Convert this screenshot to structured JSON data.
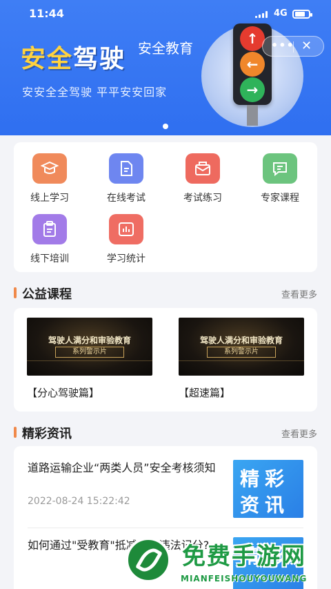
{
  "status_bar": {
    "time": "11:44",
    "network": "4G"
  },
  "banner": {
    "title_part1": "安全",
    "title_part2": "驾驶",
    "subtitle": "安全教育",
    "slogan": "安安全全驾驶  平平安安回家",
    "capsule_more": "•••",
    "capsule_close": "✕",
    "traffic_light_colors": [
      "#e53b2f",
      "#f0872b",
      "#2fb35a"
    ],
    "traffic_light_icons": [
      "up-arrow-icon",
      "left-arrow-icon",
      "right-arrow-icon"
    ],
    "carousel_pages": 1
  },
  "menu": {
    "items": [
      {
        "label": "线上学习",
        "icon": "graduation-cap-icon",
        "color": "#f08a5b"
      },
      {
        "label": "在线考试",
        "icon": "document-icon",
        "color": "#6e86f0"
      },
      {
        "label": "考试练习",
        "icon": "envelope-icon",
        "color": "#ee6a5f"
      },
      {
        "label": "专家课程",
        "icon": "chat-icon",
        "color": "#6cc47e"
      },
      {
        "label": "线下培训",
        "icon": "clipboard-icon",
        "color": "#a27be8"
      },
      {
        "label": "学习统计",
        "icon": "chart-icon",
        "color": "#ef6d63"
      }
    ]
  },
  "courses_section": {
    "title": "公益课程",
    "more": "查看更多",
    "items": [
      {
        "title": "【分心驾驶篇】",
        "thumb_line1": "驾驶人满分和审验教育",
        "thumb_line2": "系列警示片"
      },
      {
        "title": "【超速篇】",
        "thumb_line1": "驾驶人满分和审验教育",
        "thumb_line2": "系列警示片"
      }
    ]
  },
  "news_section": {
    "title": "精彩资讯",
    "more": "查看更多",
    "items": [
      {
        "title": "道路运输企业“两类人员”安全考核须知",
        "time": "2022-08-24 15:22:42",
        "img_text1": "精彩",
        "img_text2": "资讯"
      },
      {
        "title": "如何通过\"受教育\"抵减交通违法记分?",
        "time": "",
        "img_text1": "精彩",
        "img_text2": ""
      }
    ]
  },
  "watermark": {
    "title": "免费手游网",
    "subtitle": "MIANFEISHOUYOUWANG"
  }
}
